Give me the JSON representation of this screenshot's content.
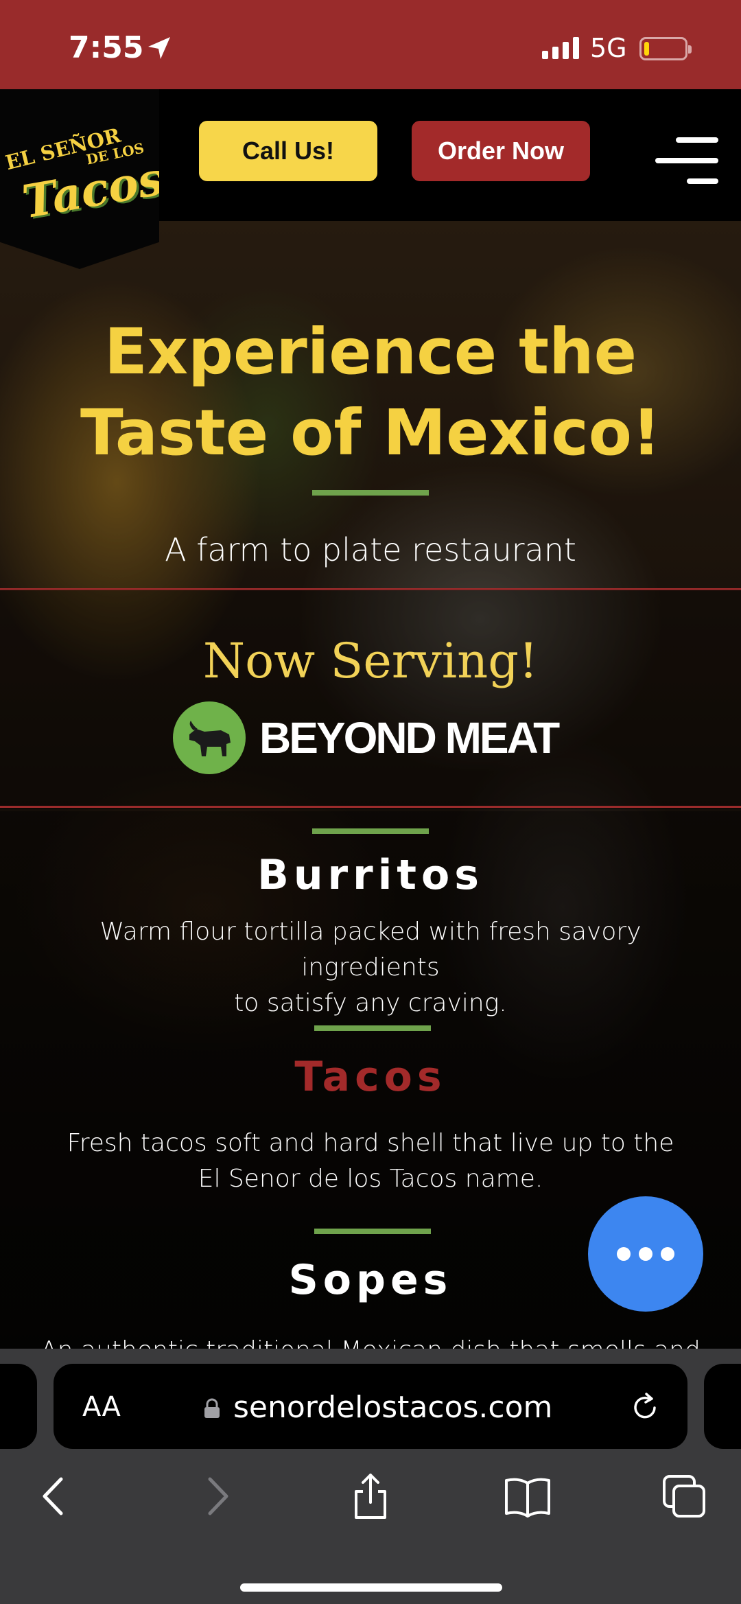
{
  "status_bar": {
    "time": "7:55",
    "network": "5G",
    "battery_level": 0.12
  },
  "brand": {
    "line1": "EL SEÑOR",
    "line2": "DE LOS",
    "line3": "Tacos"
  },
  "header": {
    "call_label": "Call Us!",
    "order_label": "Order Now"
  },
  "hero": {
    "headline_line1": "Experience the",
    "headline_line2": "Taste of Mexico!",
    "subheadline": "A farm to plate restaurant"
  },
  "promo": {
    "now_serving": "Now Serving!",
    "partner": "BEYOND MEAT"
  },
  "menu": [
    {
      "title": "Burritos",
      "desc1": "Warm flour tortilla packed with fresh savory ingredients",
      "desc2": "to satisfy any craving."
    },
    {
      "title": "Tacos",
      "desc1": "Fresh tacos soft and hard shell that live up to the",
      "desc2": "El Senor de los Tacos name."
    },
    {
      "title": "Sopes",
      "desc1": "An authentic traditional Mexican dish that smells and"
    }
  ],
  "browser": {
    "text_size_label": "AA",
    "url": "senordelostacos.com"
  },
  "colors": {
    "status_bar": "#992b2b",
    "brand_yellow": "#f5d142",
    "brand_red": "#a32a2a",
    "accent_green": "#6fa34c",
    "fab_blue": "#3d86f0"
  }
}
